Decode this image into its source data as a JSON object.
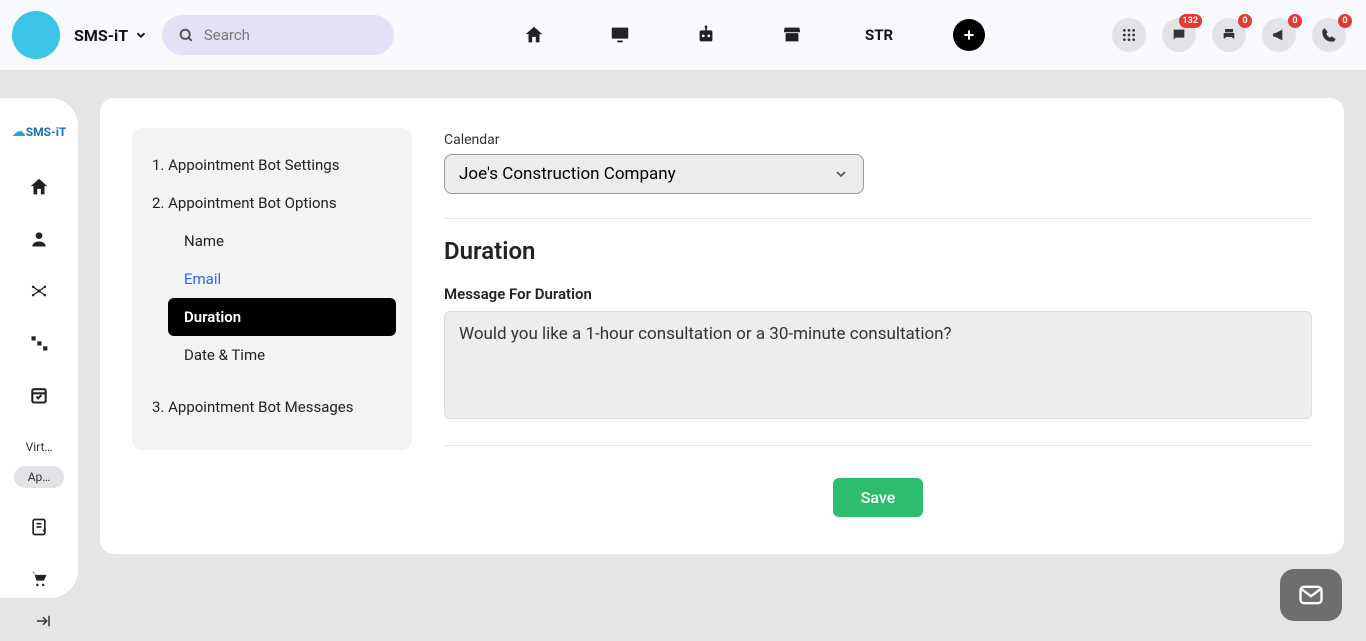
{
  "header": {
    "brand": "SMS-iT",
    "search_placeholder": "Search",
    "str_label": "STR",
    "badges": {
      "chat": "132",
      "print": "0",
      "announce": "0",
      "phone": "0"
    }
  },
  "leftbar": {
    "logo": "SMS-iT",
    "tabs": {
      "virt": "Virt…",
      "apps": "Ap…"
    }
  },
  "sidepanel": {
    "s1": "1. Appointment Bot Settings",
    "s2": "2. Appointment Bot Options",
    "name": "Name",
    "email": "Email",
    "duration": "Duration",
    "datetime": "Date & Time",
    "s3": "3. Appointment Bot Messages"
  },
  "content": {
    "calendar_label": "Calendar",
    "calendar_value": "Joe's Construction Company",
    "section_title": "Duration",
    "msg_label": "Message For Duration",
    "msg_value": "Would you like a 1-hour consultation or a 30-minute consultation?",
    "save": "Save"
  }
}
